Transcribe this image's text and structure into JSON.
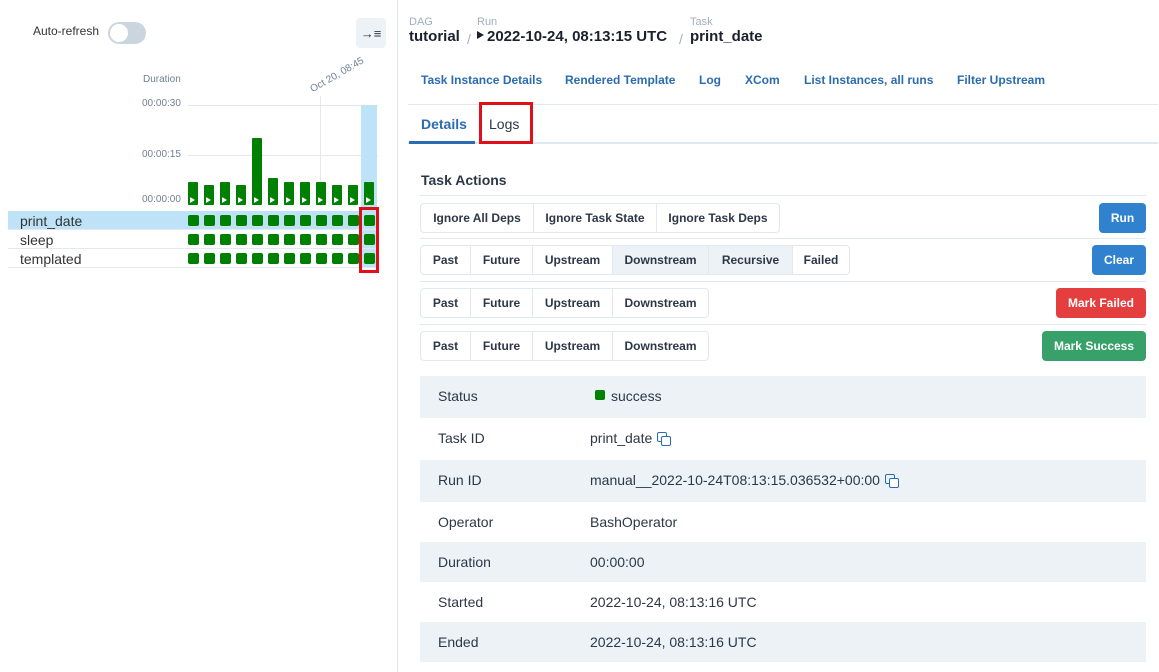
{
  "grid": {
    "autorefresh_label": "Auto-refresh",
    "duration_label": "Duration",
    "ticks": [
      "00:00:30",
      "00:00:15",
      "00:00:00"
    ],
    "date_label": "Oct 20, 08:45",
    "tasks": [
      {
        "name": "print_date",
        "selected": true
      },
      {
        "name": "sleep",
        "selected": false
      },
      {
        "name": "templated",
        "selected": false
      }
    ],
    "run_durations_seconds": [
      7,
      6,
      7,
      6,
      20,
      8,
      7,
      7,
      7,
      6,
      6,
      7
    ],
    "cell_state": "success",
    "colors": {
      "success": "#008000",
      "selected": "#bee3f8",
      "highlight": "#e0101a"
    }
  },
  "breadcrumb": {
    "dag_label": "DAG",
    "dag_value": "tutorial",
    "run_label": "Run",
    "run_value": "2022-10-24, 08:13:15 UTC",
    "task_label": "Task",
    "task_value": "print_date",
    "separator": "/"
  },
  "nav_links": [
    "Task Instance Details",
    "Rendered Template",
    "Log",
    "XCom",
    "List Instances, all runs",
    "Filter Upstream"
  ],
  "tabs": {
    "details": "Details",
    "logs": "Logs"
  },
  "task_actions": {
    "title": "Task Actions",
    "run_row": {
      "options": [
        "Ignore All Deps",
        "Ignore Task State",
        "Ignore Task Deps"
      ],
      "button": "Run",
      "color": "#3182ce"
    },
    "clear_row": {
      "options": [
        "Past",
        "Future",
        "Upstream",
        "Downstream",
        "Recursive",
        "Failed"
      ],
      "active": [
        "Downstream",
        "Recursive"
      ],
      "button": "Clear",
      "color": "#3182ce"
    },
    "failed_row": {
      "options": [
        "Past",
        "Future",
        "Upstream",
        "Downstream"
      ],
      "button": "Mark Failed",
      "color": "#e53e3e"
    },
    "success_row": {
      "options": [
        "Past",
        "Future",
        "Upstream",
        "Downstream"
      ],
      "button": "Mark Success",
      "color": "#38a169"
    }
  },
  "details": [
    {
      "key": "Status",
      "value": "success",
      "status": true
    },
    {
      "key": "Task ID",
      "value": "print_date",
      "copy": true
    },
    {
      "key": "Run ID",
      "value": "manual__2022-10-24T08:13:15.036532+00:00",
      "copy": true
    },
    {
      "key": "Operator",
      "value": "BashOperator"
    },
    {
      "key": "Duration",
      "value": "00:00:00"
    },
    {
      "key": "Started",
      "value": "2022-10-24, 08:13:16 UTC"
    },
    {
      "key": "Ended",
      "value": "2022-10-24, 08:13:16 UTC"
    }
  ]
}
